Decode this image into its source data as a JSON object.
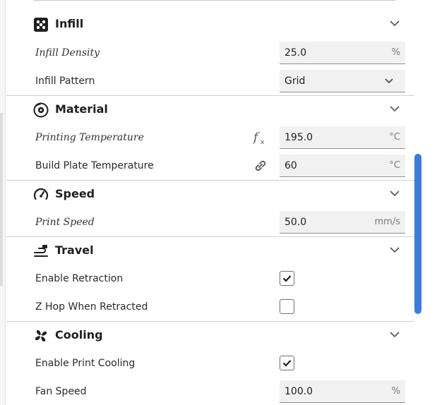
{
  "sections": {
    "infill": {
      "title": "Infill",
      "icon": "infill-icon",
      "density": {
        "label": "Infill Density",
        "value": "25.0",
        "unit": "%"
      },
      "pattern": {
        "label": "Infill Pattern",
        "value": "Grid"
      }
    },
    "material": {
      "title": "Material",
      "icon": "material-spool-icon",
      "printing_temp": {
        "label": "Printing Temperature",
        "value": "195.0",
        "unit": "°C",
        "side_icon": "function-icon"
      },
      "build_plate_temp": {
        "label": "Build Plate Temperature",
        "value": "60",
        "unit": "°C",
        "side_icon": "link-icon"
      }
    },
    "speed": {
      "title": "Speed",
      "icon": "speedometer-icon",
      "print_speed": {
        "label": "Print Speed",
        "value": "50.0",
        "unit": "mm/s"
      }
    },
    "travel": {
      "title": "Travel",
      "icon": "travel-icon",
      "retraction": {
        "label": "Enable Retraction",
        "checked": true
      },
      "z_hop": {
        "label": "Z Hop When Retracted",
        "checked": false
      }
    },
    "cooling": {
      "title": "Cooling",
      "icon": "fan-icon",
      "print_cooling": {
        "label": "Enable Print Cooling",
        "checked": true
      },
      "fan_speed": {
        "label": "Fan Speed",
        "value": "100.0",
        "unit": "%"
      }
    }
  },
  "colors": {
    "accent": "#3b7bdc",
    "field_bg": "#f1f1f1",
    "divider": "#cfcfcf"
  }
}
